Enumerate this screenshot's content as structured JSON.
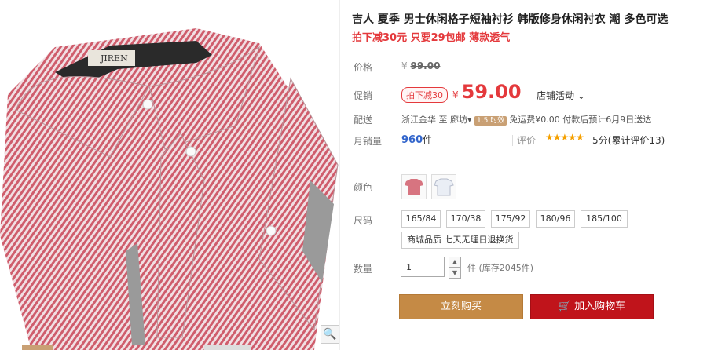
{
  "product": {
    "title": "吉人 夏季 男士休闲格子短袖衬衫 韩版修身休闲衬衣 潮 多色可选",
    "subtitle": "拍下减30元 只要29包邮 薄款透气",
    "brand_label_text": "JIREN"
  },
  "price_panel": {
    "price_label": "价格",
    "old_price_currency": "¥",
    "old_price": "99.00",
    "promo_label": "促销",
    "promo_badge": "拍下减30",
    "price_currency": "¥",
    "price": "59.00",
    "store_activity": "店铺活动",
    "shipping_label": "配送",
    "ship_from": "浙江金华",
    "ship_to_word": "至",
    "ship_to": "廊坊",
    "ship_dropdown_icon": "▾",
    "ship_tag": "1.5 时效",
    "ship_fee_text": "免运费¥0.00 付款后预计6月9日送达",
    "monthly_sales_label": "月销量",
    "monthly_sales": "960",
    "monthly_sales_unit": "件",
    "review_label": "评价",
    "stars": "★★★★★",
    "score_text": "5分(累计评价13)",
    "accent_color": "#e4393c"
  },
  "options": {
    "color_label": "颜色",
    "size_label": "尺码",
    "sizes": [
      "165/84",
      "170/38",
      "175/92",
      "180/96",
      "185/100"
    ],
    "service_tag": "商城品质  七天无理日退换货",
    "qty_label": "数量",
    "qty_value": "1",
    "qty_unit_stock": "件 (库存2045件)"
  },
  "actions": {
    "buy_now": "立刻购买",
    "add_to_cart": "加入购物车"
  },
  "icons": {
    "zoom": "zoom-icon",
    "cart": "cart-icon"
  }
}
